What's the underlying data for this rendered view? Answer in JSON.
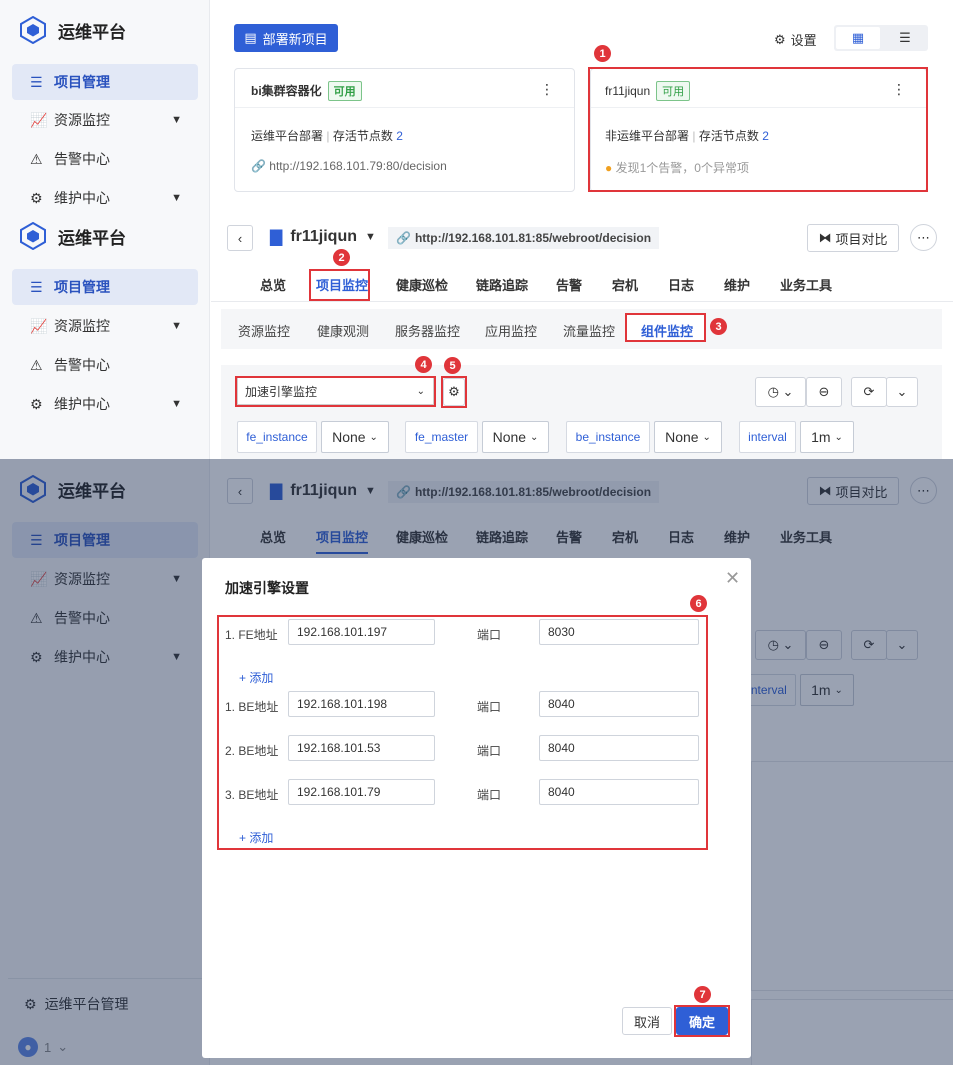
{
  "app": {
    "name": "运维平台"
  },
  "nav": {
    "items": [
      "项目管理",
      "资源监控",
      "告警中心",
      "维护中心"
    ],
    "footer_label": "运维平台管理",
    "user_label": "1"
  },
  "top": {
    "deploy_button": "部署新项目",
    "settings_label": "设置",
    "card1": {
      "title": "bi集群容器化",
      "badge": "可用",
      "line": "运维平台部署",
      "nodes_label": "存活节点数",
      "nodes": "2",
      "url": "http://192.168.101.79:80/decision"
    },
    "card2": {
      "title": "fr11jiqun",
      "badge": "可用",
      "line": "非运维平台部署",
      "nodes_label": "存活节点数",
      "nodes": "2",
      "alert": "发现1个告警，0个异常项"
    }
  },
  "project": {
    "name": "fr11jiqun",
    "url": "http://192.168.101.81:85/webroot/decision",
    "compare_button": "项目对比",
    "tabs": [
      "总览",
      "项目监控",
      "健康巡检",
      "链路追踪",
      "告警",
      "宕机",
      "日志",
      "维护",
      "业务工具"
    ],
    "subtabs": [
      "资源监控",
      "健康观测",
      "服务器监控",
      "应用监控",
      "流量监控",
      "组件监控"
    ],
    "select_value": "加速引擎监控",
    "filters": [
      {
        "label": "fe_instance",
        "value": "None"
      },
      {
        "label": "fe_master",
        "value": "None"
      },
      {
        "label": "be_instance",
        "value": "None"
      },
      {
        "label": "interval",
        "value": "1m"
      }
    ]
  },
  "dialog": {
    "title": "加速引擎设置",
    "fe": [
      {
        "label": "1. FE地址",
        "address": "192.168.101.197",
        "port_label": "端口",
        "port": "8030"
      }
    ],
    "be": [
      {
        "label": "1. BE地址",
        "address": "192.168.101.198",
        "port_label": "端口",
        "port": "8040"
      },
      {
        "label": "2. BE地址",
        "address": "192.168.101.53",
        "port_label": "端口",
        "port": "8040"
      },
      {
        "label": "3. BE地址",
        "address": "192.168.101.79",
        "port_label": "端口",
        "port": "8040"
      }
    ],
    "add_label": "+ 添加",
    "cancel": "取消",
    "confirm": "确定"
  },
  "markers": [
    "1",
    "2",
    "3",
    "4",
    "5",
    "6",
    "7"
  ],
  "colors": {
    "accent": "#2f5fd6",
    "highlight": "#e0353a",
    "success": "#2f9e44"
  }
}
